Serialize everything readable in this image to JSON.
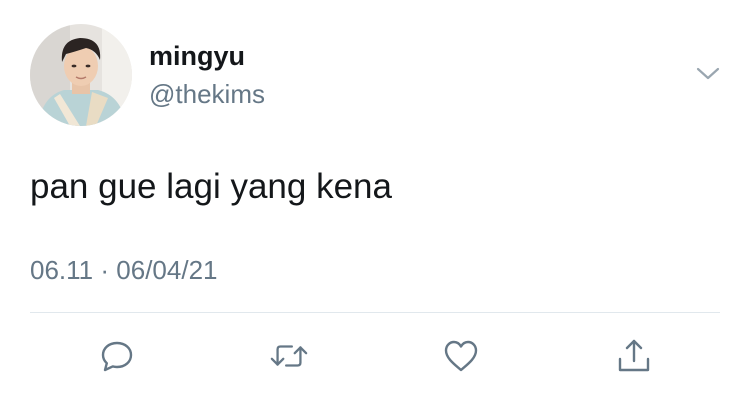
{
  "tweet": {
    "display_name": "mingyu",
    "handle": "@thekims",
    "text": "pan gue lagi yang kena",
    "time": "06.11",
    "separator": "·",
    "date": "06/04/21"
  },
  "icons": {
    "caret": "chevron-down-icon",
    "reply": "reply-icon",
    "retweet": "retweet-icon",
    "like": "heart-icon",
    "share": "share-icon"
  },
  "colors": {
    "primary_text": "#14171a",
    "secondary_text": "#657786",
    "icon": "#657786",
    "divider": "#e1e8ed"
  }
}
